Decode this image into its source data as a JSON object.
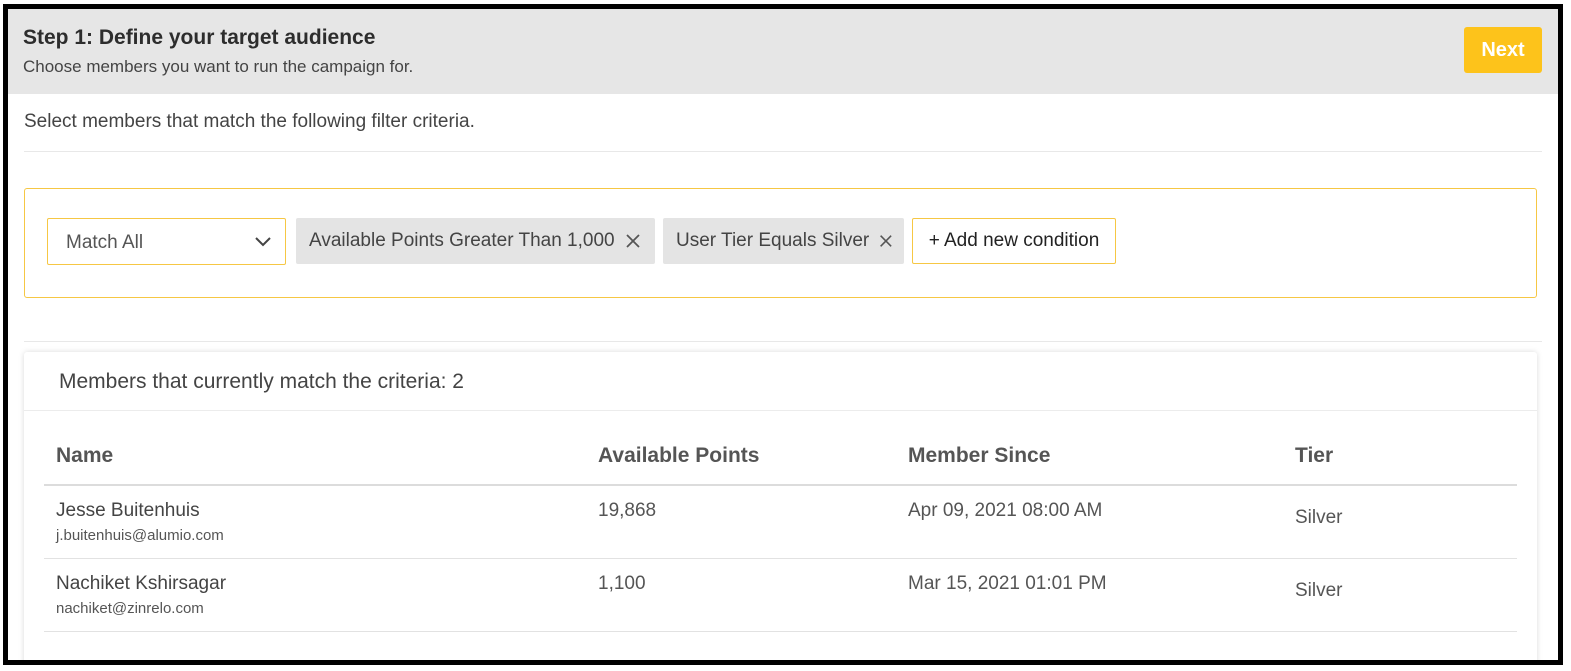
{
  "header": {
    "title": "Step 1: Define your target audience",
    "subtitle": "Choose members you want to run the campaign for.",
    "next_label": "Next",
    "accent_color": "#fdc31b"
  },
  "filter": {
    "intro": "Select members that match the following filter criteria.",
    "match_mode": "Match All",
    "conditions": [
      {
        "label": "Available Points Greater Than 1,000",
        "remove_icon": "close-icon"
      },
      {
        "label": "User Tier Equals Silver",
        "remove_icon": "close-icon"
      }
    ],
    "add_condition_label": "+ Add new condition"
  },
  "members": {
    "count_text": "Members that currently match the criteria: 2",
    "columns": [
      "Name",
      "Available Points",
      "Member Since",
      "Tier"
    ],
    "rows": [
      {
        "name": "Jesse Buitenhuis",
        "email": "j.buitenhuis@alumio.com",
        "points": "19,868",
        "since": "Apr 09, 2021 08:00 AM",
        "tier": "Silver"
      },
      {
        "name": "Nachiket Kshirsagar",
        "email": "nachiket@zinrelo.com",
        "points": "1,100",
        "since": "Mar 15, 2021 01:01 PM",
        "tier": "Silver"
      }
    ]
  }
}
